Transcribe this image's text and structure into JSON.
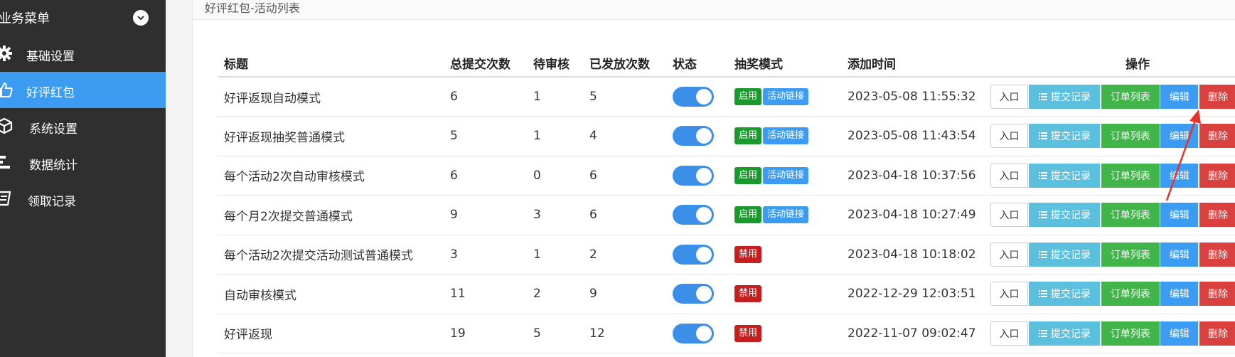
{
  "sidebar": {
    "header": "业务菜单",
    "items": [
      {
        "label": "基础设置",
        "icon": "gear-icon",
        "active": false
      },
      {
        "label": "好评红包",
        "icon": "thumbs-up-icon",
        "active": true
      },
      {
        "label": "系统设置",
        "icon": "cube-icon",
        "active": false
      },
      {
        "label": "数据统计",
        "icon": "bars-icon",
        "active": false
      },
      {
        "label": "领取记录",
        "icon": "book-icon",
        "active": false
      }
    ]
  },
  "page": {
    "title": "好评红包-活动列表"
  },
  "table": {
    "headers": [
      "标题",
      "总提交次数",
      "待审核",
      "已发放次数",
      "状态",
      "抽奖模式",
      "添加时间",
      "操作"
    ],
    "rows": [
      {
        "title": "好评返现自动模式",
        "total": "6",
        "pending": "1",
        "issued": "5",
        "mode": "启用",
        "link": "活动链接",
        "time": "2023-05-08 11:55:32"
      },
      {
        "title": "好评返现抽奖普通模式",
        "total": "5",
        "pending": "1",
        "issued": "4",
        "mode": "启用",
        "link": "活动链接",
        "time": "2023-05-08 11:43:54"
      },
      {
        "title": "每个活动2次自动审核模式",
        "total": "6",
        "pending": "0",
        "issued": "6",
        "mode": "启用",
        "link": "活动链接",
        "time": "2023-04-18 10:37:56"
      },
      {
        "title": "每个月2次提交普通模式",
        "total": "9",
        "pending": "3",
        "issued": "6",
        "mode": "启用",
        "link": "活动链接",
        "time": "2023-04-18 10:27:49"
      },
      {
        "title": "每个活动2次提交活动测试普通模式",
        "total": "3",
        "pending": "1",
        "issued": "2",
        "mode": "禁用",
        "link": "",
        "time": "2023-04-18 10:18:02"
      },
      {
        "title": "自动审核模式",
        "total": "11",
        "pending": "2",
        "issued": "9",
        "mode": "禁用",
        "link": "",
        "time": "2022-12-29 12:03:51"
      },
      {
        "title": "好评返现",
        "total": "19",
        "pending": "5",
        "issued": "12",
        "mode": "禁用",
        "link": "",
        "time": "2022-11-07 09:02:47"
      }
    ],
    "actions": {
      "entry": "入口",
      "record": "提交记录",
      "order": "订单列表",
      "edit": "编辑",
      "delete": "删除"
    }
  },
  "colors": {
    "sidebar_bg": "#2f2f2f",
    "active_nav": "#3b9cf2",
    "toggle_on": "#3b8fe8",
    "enabled_badge": "#1a9a2c",
    "disabled_badge": "#c61e1e",
    "link_badge": "#3b9cf2",
    "record_btn": "#5bc0de",
    "order_btn": "#42b54a",
    "edit_btn": "#3b9cf2",
    "delete_btn": "#d9403e",
    "annotation_arrow": "#e5322d"
  }
}
